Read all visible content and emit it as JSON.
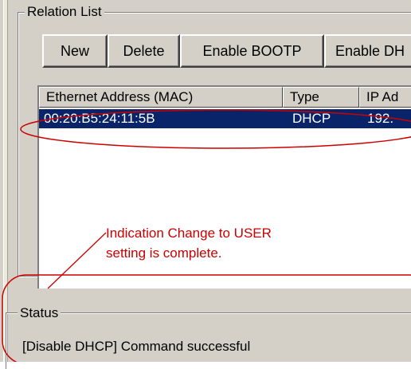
{
  "relation_list": {
    "title": "Relation List",
    "buttons": {
      "new": "New",
      "delete": "Delete",
      "enable_bootp": "Enable BOOTP",
      "enable_dhcp": "Enable DH"
    },
    "columns": {
      "mac": "Ethernet Address (MAC)",
      "type": "Type",
      "ip": "IP Ad"
    },
    "rows": [
      {
        "mac": "00:20:B5:24:11:5B",
        "type": "DHCP",
        "ip": "192."
      }
    ]
  },
  "status": {
    "title": "Status",
    "message": "[Disable DHCP] Command successful"
  },
  "annotation": {
    "line1": "Indication Change to USER",
    "line2": "setting is complete.",
    "color": "#cc0000"
  },
  "colors": {
    "selection": "#0a246a",
    "dialog_bg": "#d4d0c8"
  }
}
